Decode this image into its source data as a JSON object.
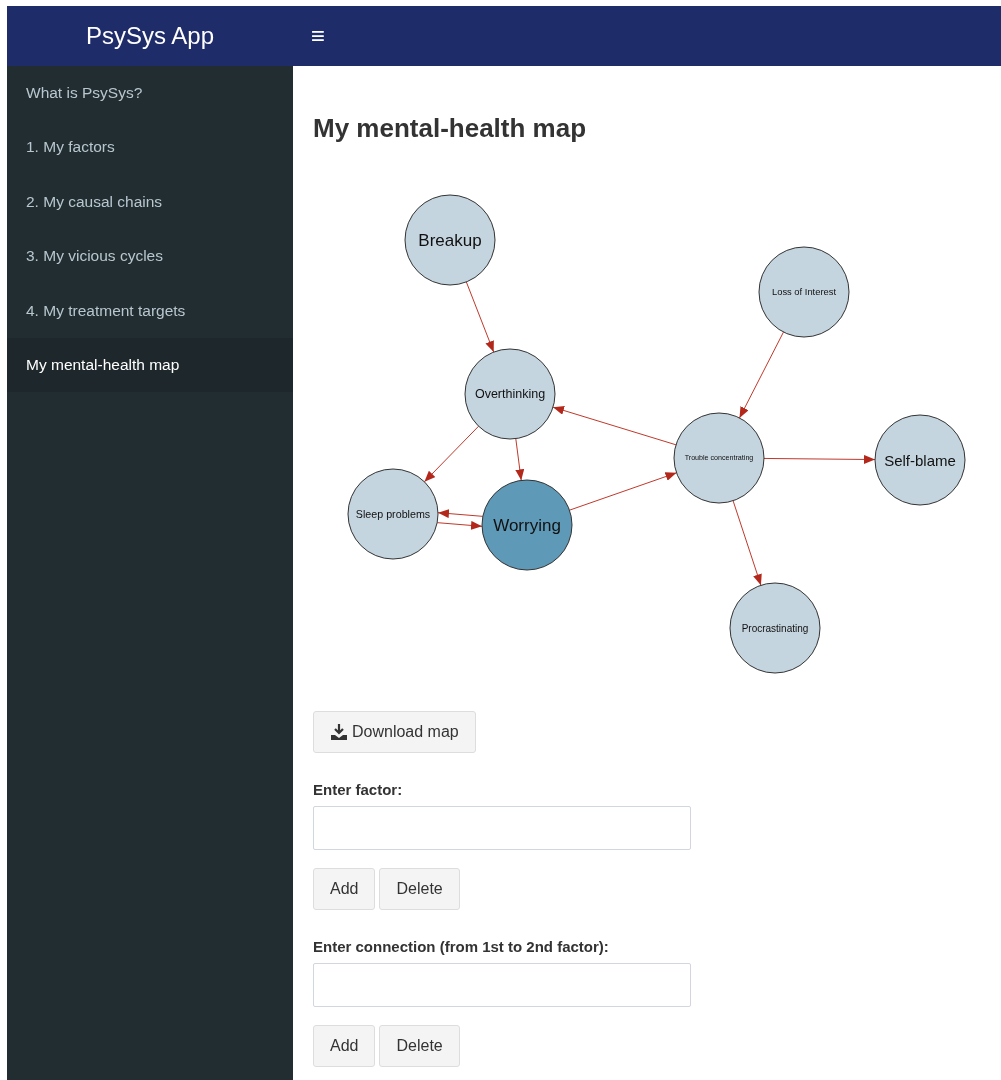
{
  "header": {
    "title": "PsySys App",
    "menu_icon": "≡"
  },
  "sidebar": {
    "items": [
      {
        "label": "What is PsySys?",
        "selected": false
      },
      {
        "label": "1. My factors",
        "selected": false
      },
      {
        "label": "2. My causal chains",
        "selected": false
      },
      {
        "label": "3. My vicious cycles",
        "selected": false
      },
      {
        "label": "4. My treatment targets",
        "selected": false
      },
      {
        "label": "My mental-health map",
        "selected": true
      }
    ]
  },
  "main": {
    "heading": "My mental-health map",
    "map": {
      "nodes": [
        {
          "label": "Breakup",
          "highlighted": false
        },
        {
          "label": "Loss of Interest",
          "highlighted": false
        },
        {
          "label": "Overthinking",
          "highlighted": false
        },
        {
          "label": "Trouble concentrating",
          "highlighted": false
        },
        {
          "label": "Self-blame",
          "highlighted": false
        },
        {
          "label": "Sleep problems",
          "highlighted": false
        },
        {
          "label": "Worrying",
          "highlighted": true
        },
        {
          "label": "Procrastinating",
          "highlighted": false
        }
      ]
    },
    "download_button": "Download map",
    "forms": [
      {
        "label": "Enter factor:",
        "buttons": [
          "Add",
          "Delete"
        ]
      },
      {
        "label": "Enter connection (from 1st to 2nd factor):",
        "buttons": [
          "Add",
          "Delete"
        ]
      }
    ]
  }
}
